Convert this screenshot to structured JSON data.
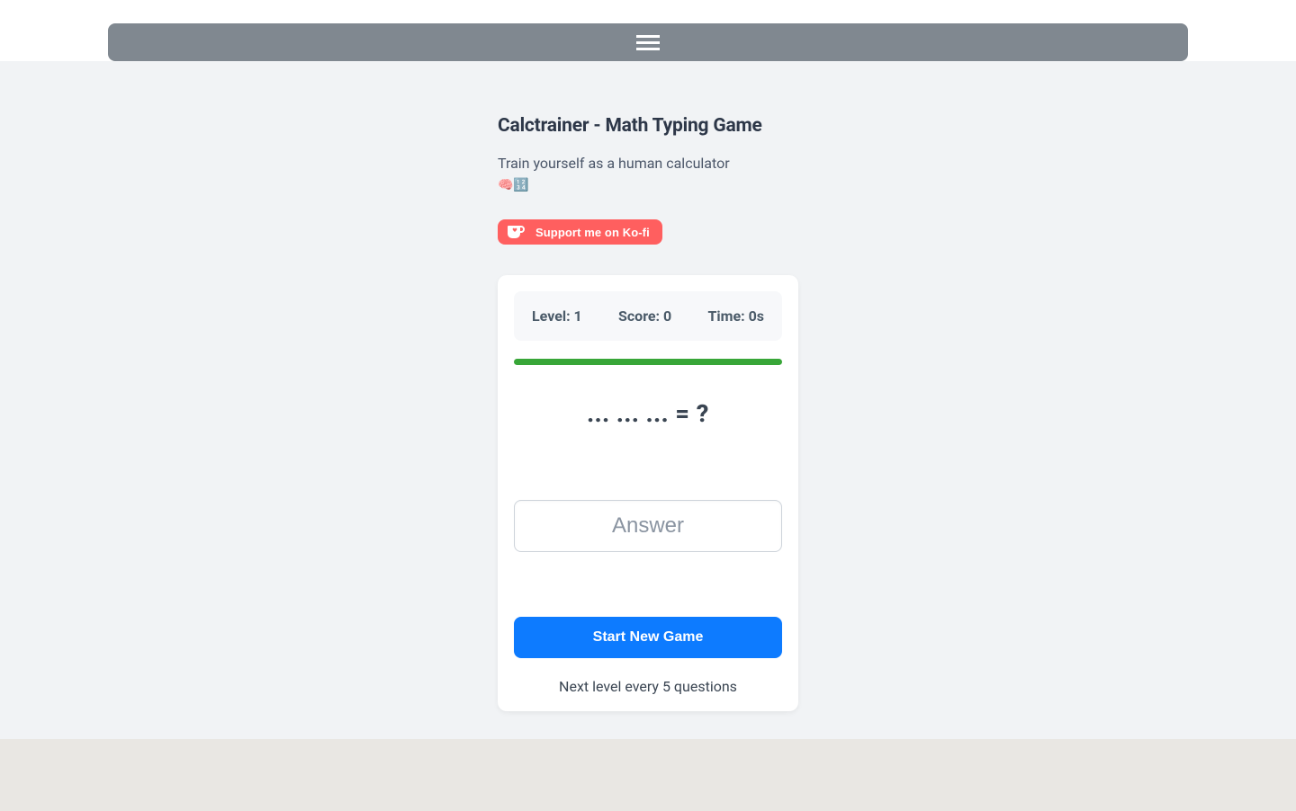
{
  "header": {
    "title": "Calctrainer - Math Typing Game",
    "subtitle": "Train yourself as a human calculator",
    "emoji": "🧠🔢"
  },
  "kofi": {
    "label": "Support me on Ko-fi"
  },
  "game": {
    "stats": {
      "level_label": "Level: 1",
      "score_label": "Score: 0",
      "time_label": "Time: 0s"
    },
    "question": "... ... ... = ?",
    "answer_placeholder": "Answer",
    "start_label": "Start New Game",
    "hint": "Next level every 5 questions"
  }
}
